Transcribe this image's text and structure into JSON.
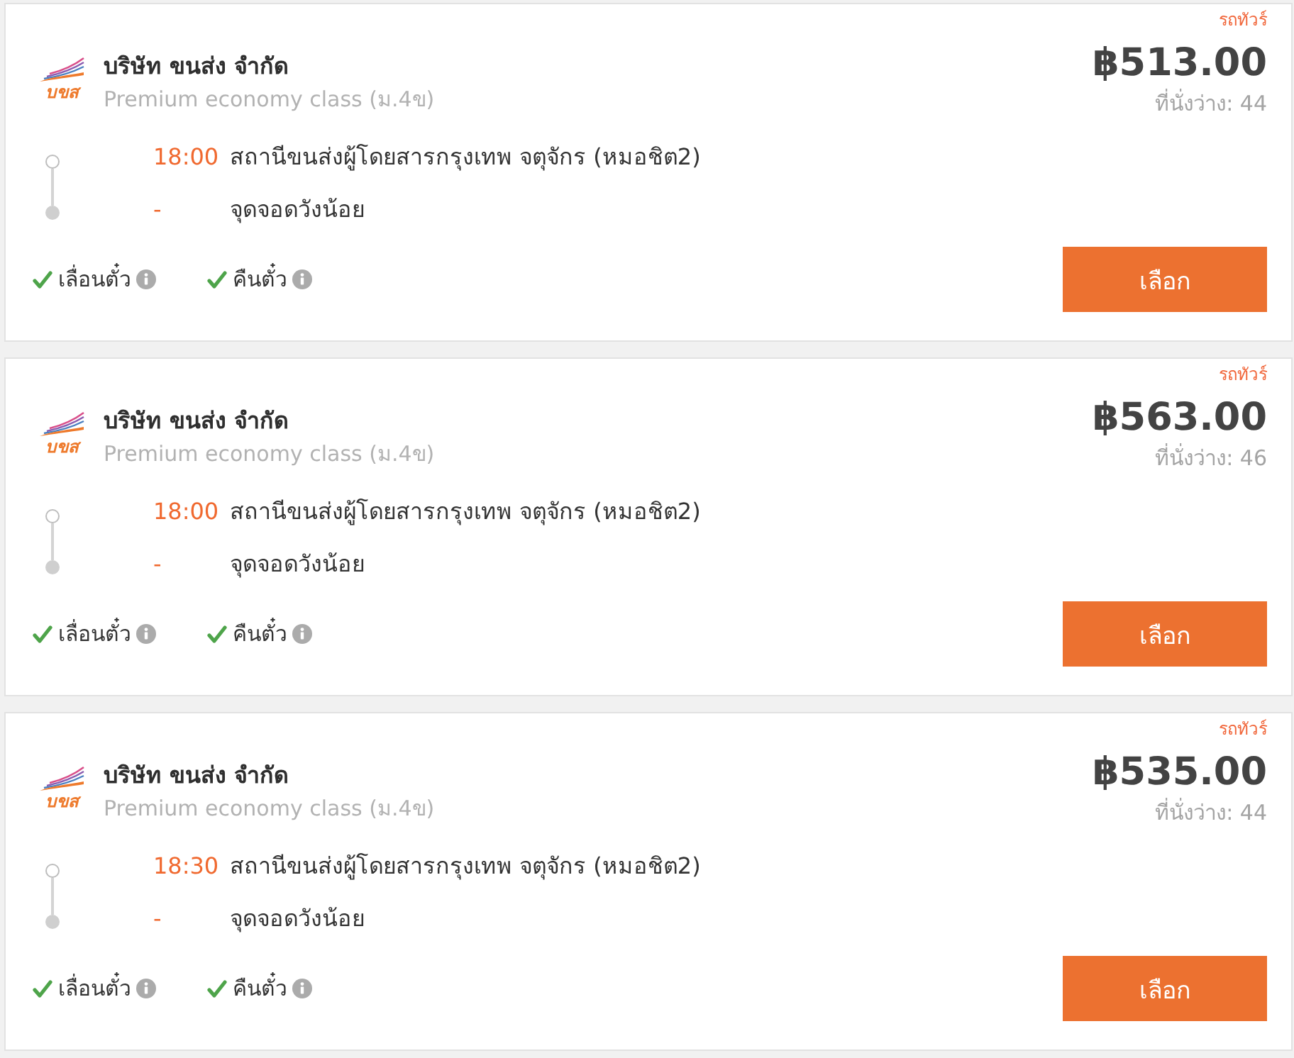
{
  "trips": [
    {
      "bus_type": "รถทัวร์",
      "operator": {
        "logo_text": "บขส",
        "name": "บริษัท ขนส่ง จำกัด",
        "class": "Premium economy class (ม.4ข)"
      },
      "price": "฿513.00",
      "seats": "ที่นั่งว่าง: 44",
      "stops": [
        {
          "kind": "departure",
          "time": "18:00",
          "name": "สถานีขนส่งผู้โดยสารกรุงเทพ จตุจักร (หมอชิต2)"
        },
        {
          "kind": "arrival",
          "time": "-",
          "name": "จุดจอดวังน้อย"
        }
      ],
      "policies": [
        {
          "label": "เลื่อนตั๋ว",
          "available": true
        },
        {
          "label": "คืนตั๋ว",
          "available": true
        }
      ],
      "button": "เลือก"
    },
    {
      "bus_type": "รถทัวร์",
      "operator": {
        "logo_text": "บขส",
        "name": "บริษัท ขนส่ง จำกัด",
        "class": "Premium economy class (ม.4ข)"
      },
      "price": "฿563.00",
      "seats": "ที่นั่งว่าง: 46",
      "stops": [
        {
          "kind": "departure",
          "time": "18:00",
          "name": "สถานีขนส่งผู้โดยสารกรุงเทพ จตุจักร (หมอชิต2)"
        },
        {
          "kind": "arrival",
          "time": "-",
          "name": "จุดจอดวังน้อย"
        }
      ],
      "policies": [
        {
          "label": "เลื่อนตั๋ว",
          "available": true
        },
        {
          "label": "คืนตั๋ว",
          "available": true
        }
      ],
      "button": "เลือก"
    },
    {
      "bus_type": "รถทัวร์",
      "operator": {
        "logo_text": "บขส",
        "name": "บริษัท ขนส่ง จำกัด",
        "class": "Premium economy class (ม.4ข)"
      },
      "price": "฿535.00",
      "seats": "ที่นั่งว่าง: 44",
      "stops": [
        {
          "kind": "departure",
          "time": "18:30",
          "name": "สถานีขนส่งผู้โดยสารกรุงเทพ จตุจักร (หมอชิต2)"
        },
        {
          "kind": "arrival",
          "time": "-",
          "name": "จุดจอดวังน้อย"
        }
      ],
      "policies": [
        {
          "label": "เลื่อนตั๋ว",
          "available": true
        },
        {
          "label": "คืนตั๋ว",
          "available": true
        }
      ],
      "button": "เลือก"
    }
  ]
}
